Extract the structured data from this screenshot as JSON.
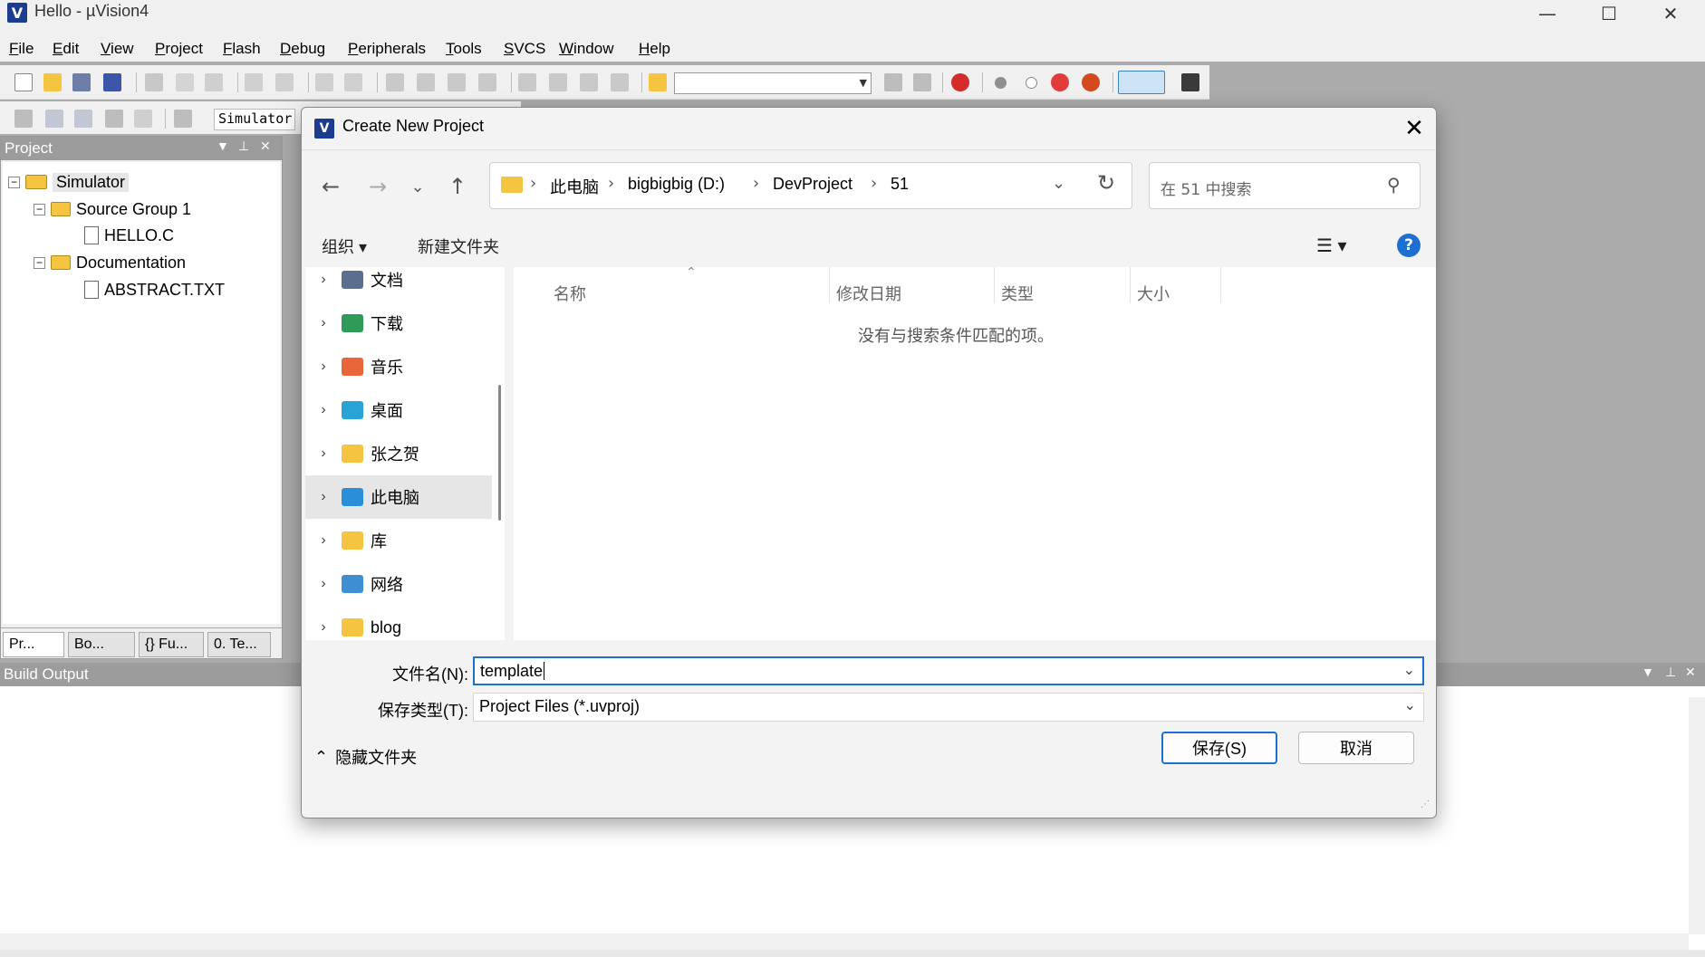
{
  "window": {
    "title": "Hello  - µVision4",
    "logo": "V",
    "controls": [
      "—",
      "☐",
      "✕"
    ]
  },
  "menu": [
    "File",
    "Edit",
    "View",
    "Project",
    "Flash",
    "Debug",
    "Peripherals",
    "Tools",
    "SVCS",
    "Window",
    "Help"
  ],
  "toolbar2": {
    "target": "Simulator"
  },
  "project_pane": {
    "header": "Project",
    "tree": [
      {
        "label": "Simulator",
        "type": "target"
      },
      {
        "label": "Source Group 1",
        "type": "folder"
      },
      {
        "label": "HELLO.C",
        "type": "file"
      },
      {
        "label": "Documentation",
        "type": "folder"
      },
      {
        "label": "ABSTRACT.TXT",
        "type": "file"
      }
    ],
    "tabs": [
      "Pr...",
      "Bo...",
      "{} Fu...",
      "0. Te..."
    ]
  },
  "build_output": {
    "header": "Build Output"
  },
  "dialog": {
    "title": "Create New Project",
    "close": "✕",
    "nav": {
      "back": "←",
      "forward": "→",
      "recent": "⌄",
      "up": "↑"
    },
    "breadcrumbs": [
      "此电脑",
      "bigbigbig (D:)",
      "DevProject",
      "51"
    ],
    "search_placeholder": "在 51 中搜索",
    "commands": {
      "organize": "组织 ▾",
      "new_folder": "新建文件夹"
    },
    "nav_pane": [
      {
        "label": "文档",
        "icon": "documents-icon",
        "color": "#5a6f8e"
      },
      {
        "label": "下载",
        "icon": "download-icon",
        "color": "#2e9c58"
      },
      {
        "label": "音乐",
        "icon": "music-icon",
        "color": "#e8663a"
      },
      {
        "label": "桌面",
        "icon": "desktop-icon",
        "color": "#29a3d6"
      },
      {
        "label": "张之贺",
        "icon": "folder-icon",
        "color": "#f5c542"
      },
      {
        "label": "此电脑",
        "icon": "computer-icon",
        "color": "#2a8fd8",
        "selected": true
      },
      {
        "label": "库",
        "icon": "library-icon",
        "color": "#f5c542"
      },
      {
        "label": "网络",
        "icon": "network-icon",
        "color": "#3d8fd1"
      },
      {
        "label": "blog",
        "icon": "folder-icon",
        "color": "#f5c542"
      }
    ],
    "columns": [
      "名称",
      "修改日期",
      "类型",
      "大小"
    ],
    "empty_message": "没有与搜索条件匹配的项。",
    "filename_label": "文件名(N):",
    "filename_value": "template",
    "filetype_label": "保存类型(T):",
    "filetype_value": "Project Files (*.uvproj)",
    "hide_folders": "隐藏文件夹",
    "save_button": "保存(S)",
    "cancel_button": "取消"
  }
}
